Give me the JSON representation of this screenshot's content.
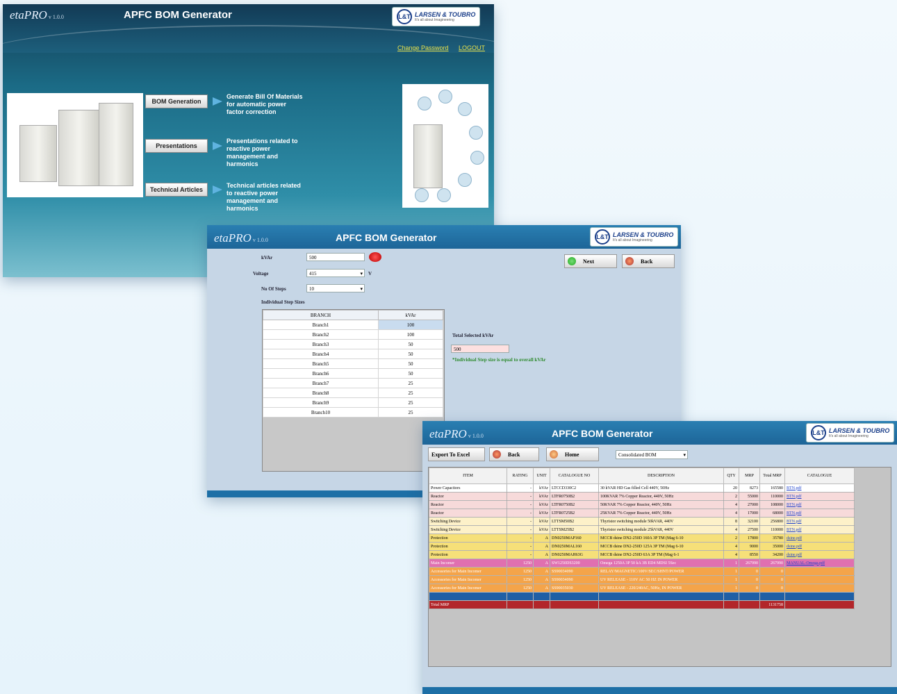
{
  "app": {
    "brand": "etaPRO",
    "version": "v 1.0.0",
    "title": "APFC BOM Generator",
    "logo_text": "LARSEN & TOUBRO",
    "logo_sub": "It's all about Imagineering",
    "logo_mark": "L&T"
  },
  "window1": {
    "links": {
      "change_password": "Change Password",
      "logout": "LOGOUT"
    },
    "menu": [
      {
        "label": "BOM Generation",
        "desc": "Generate Bill Of Materials for automatic power factor correction"
      },
      {
        "label": "Presentations",
        "desc": "Presentations related to reactive power management and harmonics"
      },
      {
        "label": "Technical Articles",
        "desc": "Technical articles related to reactive power management and harmonics"
      }
    ]
  },
  "window2": {
    "fields": {
      "kvar_label": "kVAr",
      "kvar_value": "500",
      "voltage_label": "Voltage",
      "voltage_value": "415",
      "voltage_unit": "V",
      "steps_label": "No Of Steps",
      "steps_value": "10",
      "individual_label": "Individual Step Sizes"
    },
    "buttons": {
      "next": "Next",
      "back": "Back"
    },
    "table": {
      "headers": [
        "BRANCH",
        "kVAr"
      ],
      "rows": [
        [
          "Branch1",
          "100"
        ],
        [
          "Branch2",
          "100"
        ],
        [
          "Branch3",
          "50"
        ],
        [
          "Branch4",
          "50"
        ],
        [
          "Branch5",
          "50"
        ],
        [
          "Branch6",
          "50"
        ],
        [
          "Branch7",
          "25"
        ],
        [
          "Branch8",
          "25"
        ],
        [
          "Branch9",
          "25"
        ],
        [
          "Branch10",
          "25"
        ]
      ]
    },
    "total_label": "Total Selected kVAr",
    "total_value": "500",
    "ok_message": "*Individual Step size is equal to overall kVAr"
  },
  "window3": {
    "buttons": {
      "export": "Export To Excel",
      "back": "Back",
      "home": "Home"
    },
    "view_select": "Consolidated BOM",
    "headers": [
      "ITEM",
      "RATING",
      "UNIT",
      "CATALOGUE NO",
      "DESCRIPTION",
      "QTY",
      "MRP",
      "Total MRP",
      "CATALOGUE"
    ],
    "rows": [
      {
        "cls": "r-cap",
        "c": [
          "Power Capacitors",
          "-",
          "kVAr",
          "LTCCD330C2",
          "30 kVAR HD Gas filled Cell 440V, 50Hz",
          "20",
          "8273",
          "165580",
          "BTN.pdf"
        ]
      },
      {
        "cls": "r-reac",
        "c": [
          "Reactor",
          "-",
          "kVAr",
          "LTFR0750B2",
          "100KVAR 7% Copper Reactor, 440V, 50Hz",
          "2",
          "55000",
          "110000",
          "BTN.pdf"
        ]
      },
      {
        "cls": "r-reac",
        "c": [
          "Reactor",
          "-",
          "kVAr",
          "LTFR0750B2",
          "50KVAR 7% Copper Reactor, 440V, 50Hz",
          "4",
          "27000",
          "108000",
          "BTN.pdf"
        ]
      },
      {
        "cls": "r-reac",
        "c": [
          "Reactor",
          "-",
          "kVAr",
          "LTFR0725B2",
          "25KVAR 7% Copper Reactor, 440V, 50Hz",
          "4",
          "17000",
          "68000",
          "BTN.pdf"
        ]
      },
      {
        "cls": "r-sw",
        "c": [
          "Switching Device",
          "-",
          "kVAr",
          "LTTSM50B2",
          "Thyristor switching module 50kVAR, 440V",
          "8",
          "32100",
          "256800",
          "BTN.pdf"
        ]
      },
      {
        "cls": "r-sw",
        "c": [
          "Switching Device",
          "-",
          "kVAr",
          "LTTSM25B2",
          "Thyristor switching module 25kVAR, 440V",
          "4",
          "27500",
          "110000",
          "BTN.pdf"
        ]
      },
      {
        "cls": "r-prot",
        "c": [
          "Protection",
          "-",
          "A",
          "DN0250MAP160",
          "MCCB dsine DN2-250D 160A 3P TM (Mag 6-10",
          "2",
          "17800",
          "35780",
          "dsine.pdf"
        ]
      },
      {
        "cls": "r-prot",
        "c": [
          "Protection",
          "-",
          "A",
          "DN0250MAL160",
          "MCCB dsine DN2-250D 125A 3P TM (Mag 6-10",
          "4",
          "9000",
          "35000",
          "dsine.pdf"
        ]
      },
      {
        "cls": "r-prot",
        "c": [
          "Protection",
          "-",
          "A",
          "DN0250MAH63G",
          "MCCB dsine DN2-250D 63A 3P TM (Mag 6-1",
          "4",
          "8550",
          "34200",
          "dsine.pdf"
        ]
      },
      {
        "cls": "r-main",
        "c": [
          "Main Incomer",
          "1250",
          "A",
          "SW1250DS3200",
          "Omega 1250A 3P 50 kA 3B ED4 MDSI 5Sec",
          "1",
          "267990",
          "267990",
          "MANUAL-Omega.pdf"
        ]
      },
      {
        "cls": "r-acc",
        "c": [
          "Accessories for Main Incomer",
          "1250",
          "A",
          "SS90034090",
          "RELAY/MAGNETIC/100V/SEC/SHNT/POWER",
          "1",
          "0",
          "0",
          ""
        ]
      },
      {
        "cls": "r-acc",
        "c": [
          "Accessories for Main Incomer",
          "1250",
          "A",
          "SS90034090",
          "UV RELEASE - 110V AC 50 HZ IN POWER",
          "1",
          "0",
          "0",
          ""
        ]
      },
      {
        "cls": "r-acc",
        "c": [
          "Accessories for Main Incomer",
          "1250",
          "A",
          "SS90035030",
          "UV RELEASE - 220/240AC, 50Hz, IN POWER",
          "1",
          "0",
          "0",
          ""
        ]
      },
      {
        "cls": "r-blue",
        "c": [
          "",
          "",
          "",
          "",
          "",
          "",
          "",
          "",
          ""
        ]
      },
      {
        "cls": "r-total",
        "c": [
          "Total MRP",
          "",
          "",
          "",
          "",
          "",
          "",
          "1131758",
          ""
        ]
      }
    ]
  }
}
